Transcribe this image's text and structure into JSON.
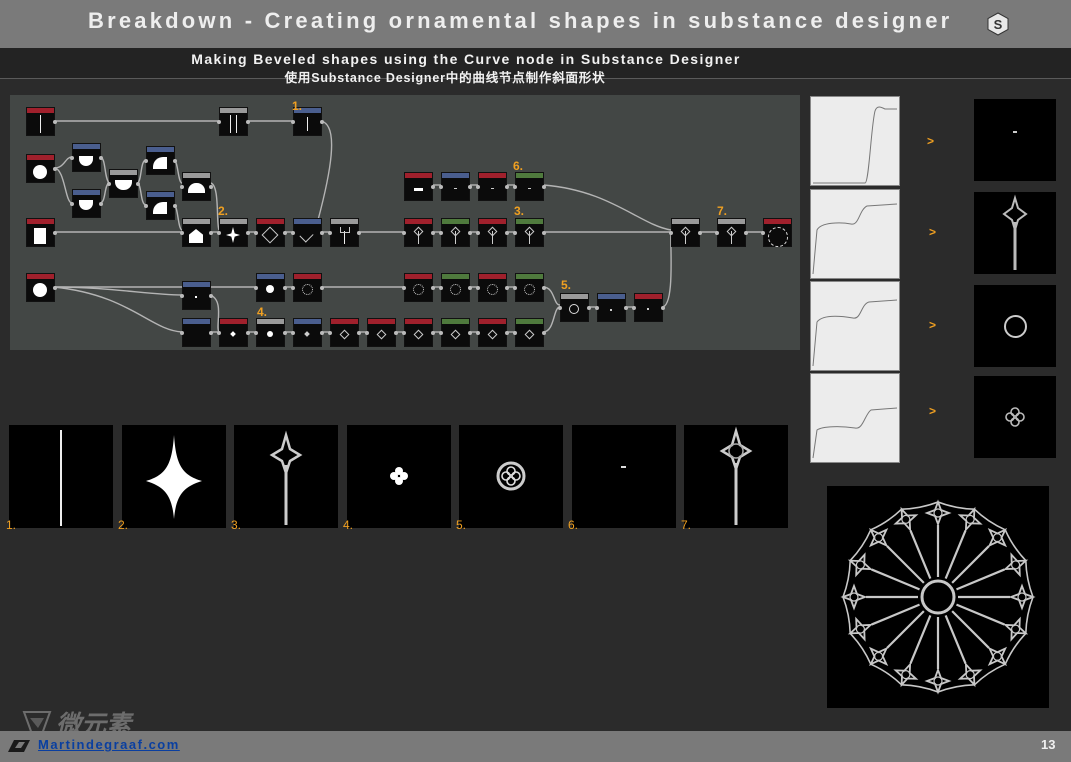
{
  "header": {
    "title": "Breakdown - Creating ornamental shapes in substance designer"
  },
  "subtitle": {
    "english": "Making Beveled shapes using the Curve node in Substance Designer",
    "chinese": "使用Substance Designer中的曲线节点制作斜面形状"
  },
  "graph": {
    "step_numbers": [
      "1.",
      "2.",
      "3.",
      "4.",
      "5.",
      "6.",
      "7."
    ]
  },
  "side_panel": {
    "arrows": [
      ">",
      ">",
      ">",
      ">"
    ]
  },
  "result_strip": {
    "labels": [
      "1.",
      "2.",
      "3.",
      "4.",
      "5.",
      "6.",
      "7."
    ]
  },
  "footer": {
    "link": "Martindegraaf.com",
    "page": "13"
  },
  "colors": {
    "accent": "#f0a021",
    "title_bar": "#7a7a7a",
    "background": "#2b2b2b",
    "graph_bg": "#434745",
    "node_header_red": "#a0202c",
    "node_header_blue": "#4a5e8e",
    "node_header_green": "#4f7a3d",
    "node_header_gray": "#9a9a9a",
    "link": "#0a3fa0"
  }
}
